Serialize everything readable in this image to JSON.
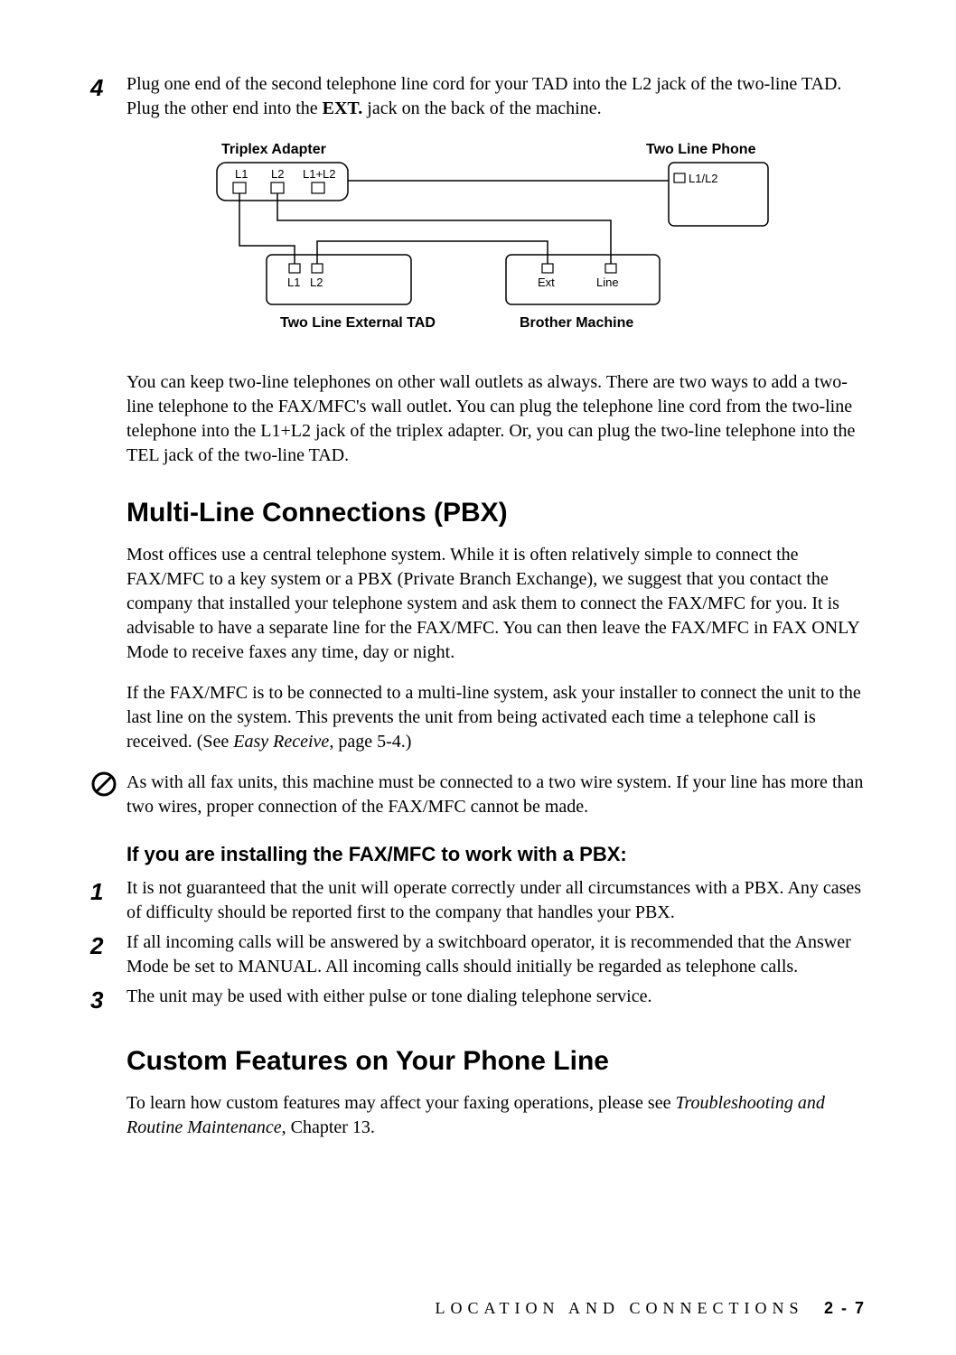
{
  "step4": {
    "num": "4",
    "text_a": "Plug one end of the second telephone line cord for your TAD into the L2 jack of the two-line TAD. Plug the other end into the ",
    "bold": "EXT.",
    "text_b": " jack on the back of the machine."
  },
  "diagram": {
    "triplex_adapter": "Triplex Adapter",
    "l1": "L1",
    "l2": "L2",
    "l1l2": "L1+L2",
    "two_line_phone": "Two Line Phone",
    "phone_l1l2": "L1/L2",
    "tad_l1": "L1",
    "tad_l2": "L2",
    "ext": "Ext",
    "line": "Line",
    "two_line_tad": "Two Line External TAD",
    "brother_machine": "Brother Machine"
  },
  "para_keep": "You can keep two-line telephones on other wall outlets as always. There are two ways to add a two-line telephone to the FAX/MFC's wall outlet. You can plug the telephone line cord from the two-line telephone into the L1+L2 jack of the triplex adapter.  Or, you can plug the two-line telephone into the TEL jack of the two-line TAD.",
  "h2_pbx": "Multi-Line Connections (PBX)",
  "para_pbx1": "Most offices use a central telephone system. While it is often relatively simple to connect the FAX/MFC to a key system or a PBX (Private Branch Exchange), we suggest that you contact the company that installed your telephone system and ask them to connect the FAX/MFC for you. It is advisable to have a separate line for the FAX/MFC. You can then leave the FAX/MFC in FAX ONLY Mode to receive faxes any time, day or night.",
  "para_pbx2_a": "If the FAX/MFC is to be connected to a multi-line system, ask your installer to connect the unit to the last line on the system. This prevents the unit from being activated each time a telephone call is received. (See ",
  "para_pbx2_i": "Easy Receive",
  "para_pbx2_b": ", page 5-4.)",
  "note": "As with all fax units, this machine must be connected to a two wire system. If your line has more than two wires, proper connection of the FAX/MFC cannot be made.",
  "h3_install": "If you are installing the FAX/MFC to work with a PBX:",
  "step1": {
    "num": "1",
    "text": "It is not guaranteed that the unit will operate correctly under all circumstances with a PBX. Any cases of difficulty should be reported first to the company that handles your PBX."
  },
  "step2": {
    "num": "2",
    "text": "If all incoming calls will be answered by a switchboard operator, it is recommended that the Answer Mode be set to MANUAL. All incoming calls should initially be regarded as telephone calls."
  },
  "step3": {
    "num": "3",
    "text": "The unit may be used with either pulse or tone dialing telephone service."
  },
  "h2_custom": "Custom Features on Your Phone Line",
  "para_custom_a": "To learn how custom features may affect your faxing operations, please see ",
  "para_custom_i": "Troubleshooting and Routine Maintenance",
  "para_custom_b": ", Chapter 13.",
  "footer": {
    "chapter": "LOCATION AND CONNECTIONS",
    "page": "2 - 7"
  }
}
